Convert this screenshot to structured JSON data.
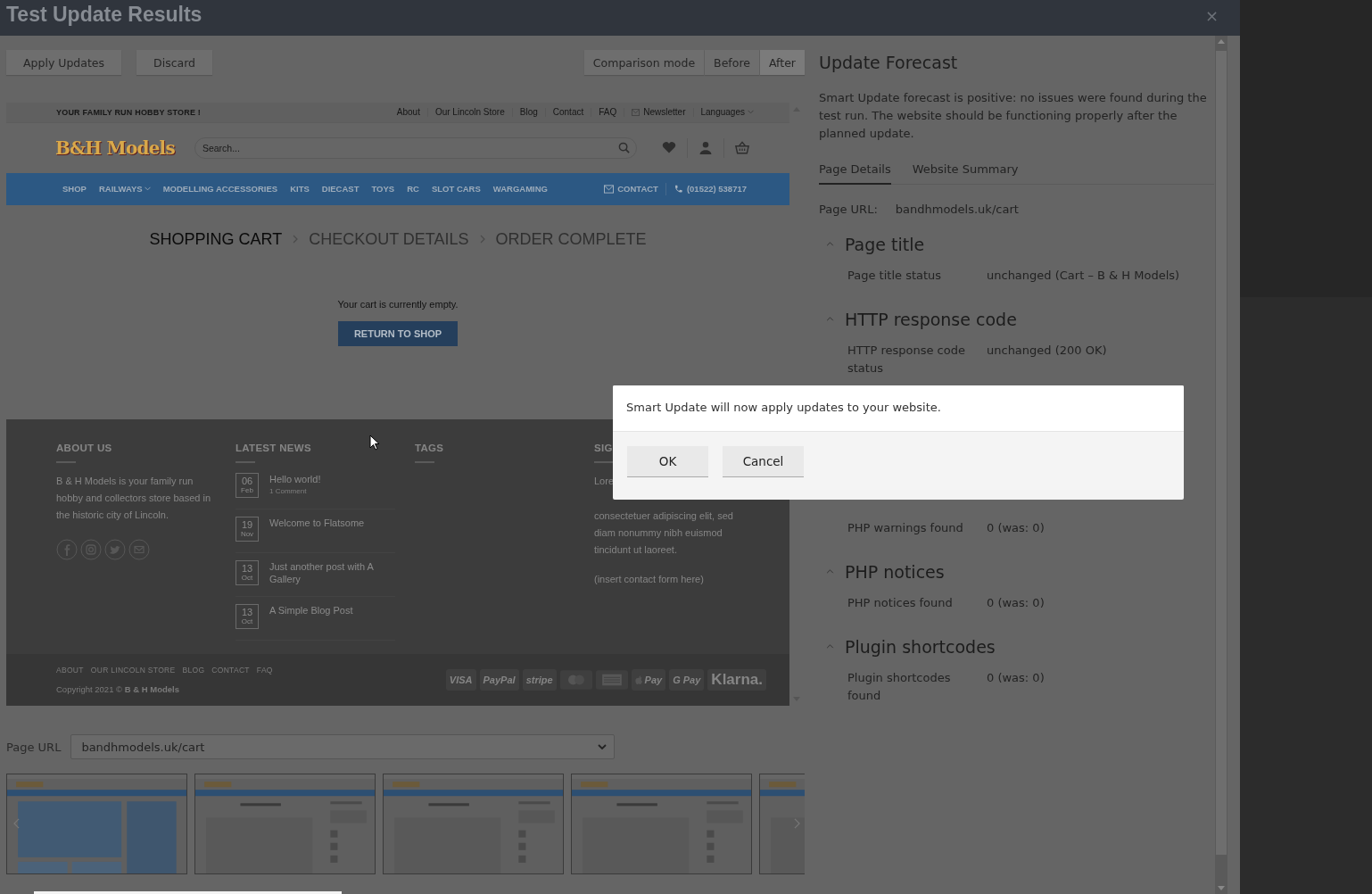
{
  "window": {
    "title": "Test Update Results",
    "close": "×"
  },
  "toolbar": {
    "actions": [
      "Apply Updates",
      "Discard"
    ],
    "modes": [
      {
        "label": "Comparison mode",
        "selected": false
      },
      {
        "label": "Before",
        "selected": false
      },
      {
        "label": "After",
        "selected": true
      }
    ]
  },
  "preview": {
    "tagline": "YOUR FAMILY RUN HOBBY STORE !",
    "top_links": [
      {
        "label": "About",
        "kind": "link"
      },
      {
        "label": "Our Lincoln Store",
        "kind": "link"
      },
      {
        "label": "Blog",
        "kind": "link"
      },
      {
        "label": "Contact",
        "kind": "link"
      },
      {
        "label": "FAQ",
        "kind": "link"
      },
      {
        "label": "Newsletter",
        "kind": "mail"
      },
      {
        "label": "Languages",
        "kind": "dropdown"
      }
    ],
    "logo": "B&H Models",
    "search": {
      "placeholder": "Search..."
    },
    "nav": [
      {
        "label": "SHOP",
        "kind": "link"
      },
      {
        "label": "RAILWAYS",
        "kind": "dropdown"
      },
      {
        "label": "MODELLING ACCESSORIES",
        "kind": "link"
      },
      {
        "label": "KITS",
        "kind": "link"
      },
      {
        "label": "DIECAST",
        "kind": "link"
      },
      {
        "label": "TOYS",
        "kind": "link"
      },
      {
        "label": "RC",
        "kind": "link"
      },
      {
        "label": "SLOT CARS",
        "kind": "link"
      },
      {
        "label": "WARGAMING",
        "kind": "link"
      }
    ],
    "nav_right": [
      {
        "label": "CONTACT",
        "kind": "mail"
      },
      {
        "label": "(01522) 538717",
        "kind": "phone"
      }
    ],
    "steps": [
      {
        "label": "SHOPPING CART",
        "selected": true
      },
      {
        "label": "CHECKOUT DETAILS",
        "selected": false
      },
      {
        "label": "ORDER COMPLETE",
        "selected": false
      }
    ],
    "empty_message": "Your cart is currently empty.",
    "return_button": "RETURN TO SHOP",
    "footer": {
      "about": {
        "heading": "ABOUT US",
        "text": "B & H Models is your family run hobby and collectors store based in the historic city of Lincoln."
      },
      "news": {
        "heading": "LATEST NEWS",
        "items": [
          {
            "day": "06",
            "month": "Feb",
            "title": "Hello world!",
            "meta": "1 Comment"
          },
          {
            "day": "19",
            "month": "Nov",
            "title": "Welcome to Flatsome"
          },
          {
            "day": "13",
            "month": "Oct",
            "title": "Just another post with A Gallery"
          },
          {
            "day": "13",
            "month": "Oct",
            "title": "A Simple Blog Post"
          }
        ]
      },
      "tags": {
        "heading": "TAGS"
      },
      "signup": {
        "heading": "SIG",
        "first_line": "Lore",
        "text": "consectetuer adipiscing elit, sed diam nonummy nibh euismod tincidunt ut laoreet.",
        "note": "(insert contact form here)"
      }
    },
    "bottom_links": [
      "ABOUT",
      "OUR LINCOLN STORE",
      "BLOG",
      "CONTACT",
      "FAQ"
    ],
    "copyright": "Copyright 2021 © **B & H Models**",
    "payments": [
      {
        "label": "VISA",
        "kind": "text"
      },
      {
        "label": "PayPal",
        "kind": "text"
      },
      {
        "label": "stripe",
        "kind": "text"
      },
      {
        "kind": "mastercard"
      },
      {
        "kind": "amex"
      },
      {
        "label": "Pay",
        "kind": "apple"
      },
      {
        "label": "G Pay",
        "kind": "text"
      },
      {
        "label": "Klarna.",
        "kind": "text"
      }
    ]
  },
  "page_url": {
    "label": "Page URL",
    "value": "bandhmodels.uk/cart"
  },
  "forecast": {
    "title": "Update Forecast",
    "summary": "Smart Update forecast is positive: no issues were found during the test run. The website should be functioning properly after the planned update.",
    "tabs": [
      {
        "label": "Page Details",
        "selected": true
      },
      {
        "label": "Website Summary",
        "selected": false
      }
    ],
    "url_label": "Page URL:",
    "url": "bandhmodels.uk/cart",
    "sections": [
      {
        "title": "Page title",
        "expanded": true,
        "rows": [
          {
            "label": "Page title status",
            "value": "unchanged (Cart – B & H Models)"
          }
        ]
      },
      {
        "title": "HTTP response code",
        "expanded": true,
        "rows": [
          {
            "label": "HTTP response code status",
            "value": "unchanged (200 OK)"
          }
        ]
      },
      {
        "rows": [
          {
            "label": "PHP warnings found",
            "value": "0 (was: 0)"
          }
        ]
      },
      {
        "title": "PHP notices",
        "expanded": true,
        "rows": [
          {
            "label": "PHP notices found",
            "value": "0 (was: 0)"
          }
        ]
      },
      {
        "title": "Plugin shortcodes",
        "expanded": true,
        "rows": [
          {
            "label": "Plugin shortcodes found",
            "value": "0 (was: 0)"
          }
        ]
      }
    ]
  },
  "dialog": {
    "message": "Smart Update will now apply updates to your website.",
    "buttons": [
      "OK",
      "Cancel"
    ]
  }
}
